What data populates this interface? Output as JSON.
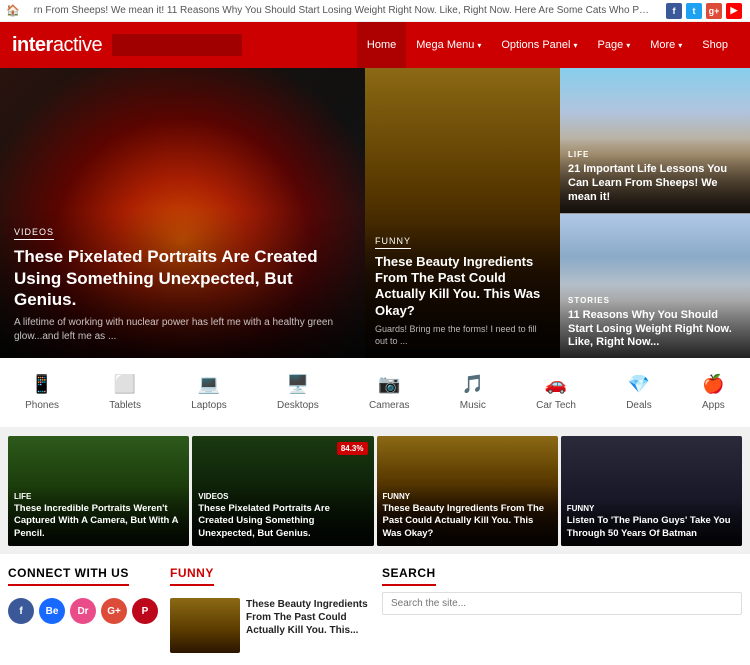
{
  "ticker": {
    "text": "rn From Sheeps! We mean it!   11 Reasons Why You Should Start Losing Weight Right Now. Like, Right Now.   Here Are Some Cats Who Prove Why They A",
    "icons": [
      "f",
      "t",
      "g+",
      "▶"
    ]
  },
  "header": {
    "logo_bold": "inter",
    "logo_light": "active",
    "search_placeholder": "",
    "nav_items": [
      {
        "label": "Home",
        "has_arrow": false
      },
      {
        "label": "Mega Menu",
        "has_arrow": true
      },
      {
        "label": "Options Panel",
        "has_arrow": true
      },
      {
        "label": "Page",
        "has_arrow": true
      },
      {
        "label": "More",
        "has_arrow": true
      },
      {
        "label": "Shop",
        "has_arrow": false
      }
    ]
  },
  "hero": {
    "left": {
      "tag": "VIDEOS",
      "title": "These Pixelated Portraits Are Created Using Something Unexpected, But Genius.",
      "excerpt": "A lifetime of working with nuclear power has left me with a healthy green glow...and left me as ..."
    },
    "middle": {
      "tag": "FUNNY",
      "title": "These Beauty Ingredients From The Past Could Actually Kill You. This Was Okay?",
      "excerpt": "Guards! Bring me the forms! I need to fill out to ..."
    },
    "right_top": {
      "tag": "LIFE",
      "title": "21 Important Life Lessons You Can Learn From Sheeps! We mean it!"
    },
    "right_bottom": {
      "tag": "STORIES",
      "title": "11 Reasons Why You Should Start Losing Weight Right Now. Like, Right Now..."
    }
  },
  "categories": [
    {
      "icon": "📱",
      "label": "Phones"
    },
    {
      "icon": "⬜",
      "label": "Tablets"
    },
    {
      "icon": "💻",
      "label": "Laptops"
    },
    {
      "icon": "🖥️",
      "label": "Desktops"
    },
    {
      "icon": "📷",
      "label": "Cameras"
    },
    {
      "icon": "🎵",
      "label": "Music"
    },
    {
      "icon": "🚗",
      "label": "Car Tech"
    },
    {
      "icon": "💎",
      "label": "Deals"
    },
    {
      "icon": "🍎",
      "label": "Apps"
    }
  ],
  "featured": [
    {
      "tag": "LIFE",
      "title": "These Incredible Portraits Weren't Captured With A Camera, But With A Pencil.",
      "badge": null,
      "img_class": "green"
    },
    {
      "tag": "VIDEOS",
      "title": "These Pixelated Portraits Are Created Using Something Unexpected, But Genius.",
      "badge": "84.3%",
      "img_class": "dark-green"
    },
    {
      "tag": "FUNNY",
      "title": "These Beauty Ingredients From The Past Could Actually Kill You. This Was Okay?",
      "badge": null,
      "img_class": "camera"
    },
    {
      "tag": "FUNNY",
      "title": "Listen To 'The Piano Guys' Take You Through 50 Years Of Batman",
      "badge": null,
      "img_class": "laptop"
    }
  ],
  "bottom": {
    "connect": {
      "title": "CONNECT WITH US"
    },
    "funny": {
      "title": "FUNNY",
      "article_title": "These Beauty Ingredients From The Past Could Actually Kill You. This..."
    },
    "search": {
      "title": "SEARCH",
      "placeholder": "Search the site..."
    }
  }
}
